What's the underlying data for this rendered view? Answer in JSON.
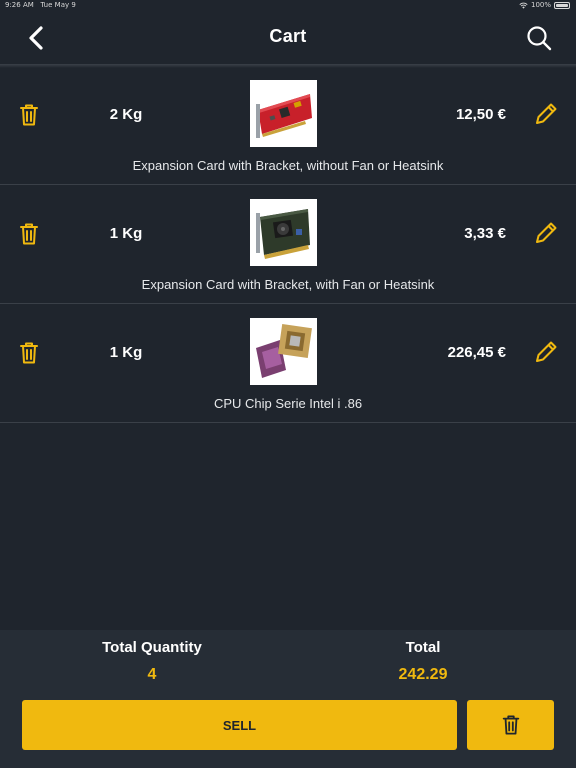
{
  "status_bar": {
    "time": "9:26 AM",
    "date": "Tue May 9",
    "battery": "100%"
  },
  "header": {
    "title": "Cart"
  },
  "items": [
    {
      "qty": "2  Kg",
      "price": "12,50 €",
      "name": "Expansion Card with Bracket, without Fan or Heatsink"
    },
    {
      "qty": "1  Kg",
      "price": "3,33 €",
      "name": "Expansion Card with Bracket, with Fan or Heatsink"
    },
    {
      "qty": "1  Kg",
      "price": "226,45 €",
      "name": "CPU Chip Serie Intel i .86"
    }
  ],
  "footer": {
    "total_quantity_label": "Total Quantity",
    "total_quantity_value": "4",
    "total_label": "Total",
    "total_value": "242.29",
    "sell_label": "SELL"
  },
  "colors": {
    "background": "#1f252d",
    "accent": "#f0b90f",
    "footer": "#262d36"
  },
  "icons": [
    "back-chevron-icon",
    "search-icon",
    "trash-icon",
    "pencil-icon"
  ]
}
